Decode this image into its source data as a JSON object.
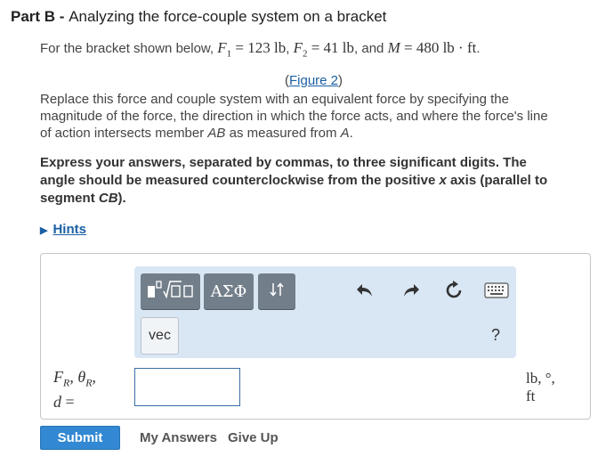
{
  "header": {
    "part_label": "Part B",
    "separator": " - ",
    "title": "Analyzing the force-couple system on a bracket"
  },
  "problem": {
    "intro": "For the bracket shown below, ",
    "f1_sym": "F",
    "f1_sub": "1",
    "f1_val": " = 123 lb",
    "sep1": ", ",
    "f2_sym": "F",
    "f2_sub": "2",
    "f2_val": " = 41 lb",
    "sep2": ", and ",
    "m_sym": "M",
    "m_val": " = 480 lb · ft",
    "end": ".",
    "figure_open": "(",
    "figure_link": "Figure 2",
    "figure_close": ")",
    "instruction_1": "Replace this force and couple system with an equivalent force by specifying the",
    "instruction_2": "magnitude of the force, the direction in which the force acts, and where the force's line",
    "instruction_3a": "of action intersects member ",
    "instruction_3b": "AB",
    "instruction_3c": " as measured from ",
    "instruction_3d": "A",
    "instruction_3e": "."
  },
  "directions": {
    "line_1": "Express your answers, separated by commas, to three significant digits. The",
    "line_2a": "angle should be measured counterclockwise from the positive ",
    "line_2b": "x",
    "line_2c": " axis (parallel to",
    "line_3a": "segment ",
    "line_3b": "CB",
    "line_3c": ")."
  },
  "hints": {
    "label": "Hints"
  },
  "toolbar": {
    "greek_label": "ΑΣΦ",
    "vec_label": "vec",
    "help_label": "?"
  },
  "answer": {
    "prefix_fr": "F",
    "prefix_fr_sub": "R",
    "prefix_theta": "θ",
    "prefix_theta_sub": "R",
    "prefix_d": "d",
    "prefix_eq": " =",
    "value": "",
    "units_line1": "lb, °,",
    "units_line2": "ft"
  },
  "actions": {
    "submit": "Submit",
    "my_answers": "My Answers",
    "give_up": "Give Up"
  },
  "colors": {
    "link": "#1a5fa3",
    "submit_bg": "#3288d2",
    "toolbar_bg": "#d9e6f4",
    "tool_button": "#727e89"
  },
  "icons": [
    "templates-icon",
    "greek-icon",
    "arrows-icon",
    "undo-icon",
    "redo-icon",
    "reset-icon",
    "keyboard-icon",
    "help-icon"
  ]
}
